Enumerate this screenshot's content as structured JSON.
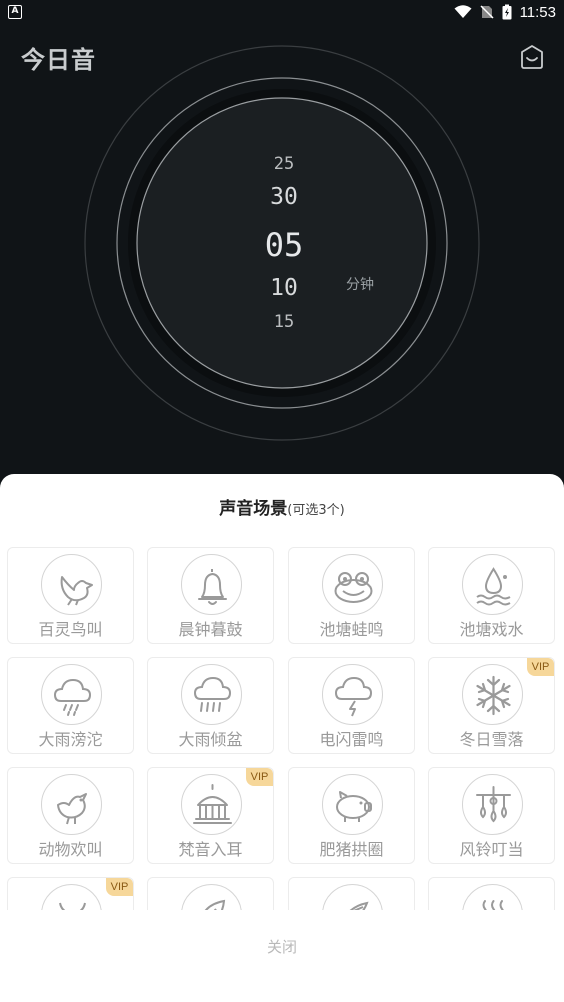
{
  "status_bar": {
    "app_badge": "A",
    "time": "11:53"
  },
  "header": {
    "title": "今日音"
  },
  "timer": {
    "numbers": [
      "25",
      "30",
      "05",
      "10",
      "15"
    ],
    "unit": "分钟"
  },
  "sheet": {
    "title": "声音场景",
    "hint": "(可选3个)",
    "close_label": "关闭",
    "vip_label": "VIP",
    "scenes": [
      {
        "label": "百灵鸟叫",
        "icon": "bird-icon",
        "vip": false
      },
      {
        "label": "晨钟暮鼓",
        "icon": "bell-icon",
        "vip": false
      },
      {
        "label": "池塘蛙鸣",
        "icon": "frog-icon",
        "vip": false
      },
      {
        "label": "池塘戏水",
        "icon": "water-drop-icon",
        "vip": false
      },
      {
        "label": "大雨滂沱",
        "icon": "rain-cloud-icon",
        "vip": false
      },
      {
        "label": "大雨倾盆",
        "icon": "heavy-rain-cloud-icon",
        "vip": false
      },
      {
        "label": "电闪雷鸣",
        "icon": "thunder-cloud-icon",
        "vip": false
      },
      {
        "label": "冬日雪落",
        "icon": "snowflake-icon",
        "vip": true
      },
      {
        "label": "动物欢叫",
        "icon": "rooster-icon",
        "vip": false
      },
      {
        "label": "梵音入耳",
        "icon": "temple-icon",
        "vip": true
      },
      {
        "label": "肥猪拱圈",
        "icon": "pig-icon",
        "vip": false
      },
      {
        "label": "风铃叮当",
        "icon": "wind-chime-icon",
        "vip": false
      },
      {
        "label": "",
        "icon": "ox-icon",
        "vip": true
      },
      {
        "label": "",
        "icon": "leaf-icon",
        "vip": false
      },
      {
        "label": "",
        "icon": "feather-icon",
        "vip": false
      },
      {
        "label": "",
        "icon": "steam-icon",
        "vip": false
      }
    ]
  }
}
